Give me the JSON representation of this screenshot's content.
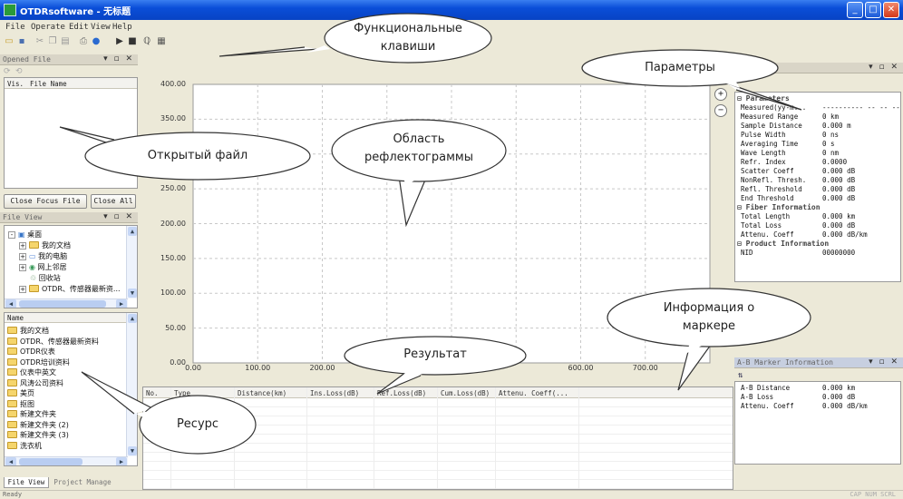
{
  "window": {
    "title": "OTDRsoftware - 无标题"
  },
  "menu": [
    "File",
    "Operate",
    "Edit",
    "View",
    "Help"
  ],
  "opened_file": {
    "title": "Opened File",
    "columns": [
      "Vis.",
      "File Name"
    ],
    "close_focus": "Close Focus File",
    "close_all": "Close All"
  },
  "file_view": {
    "title": "File View",
    "tree": [
      {
        "label": "桌面",
        "level": 0,
        "pm": "-"
      },
      {
        "label": "我的文档",
        "level": 1,
        "pm": "+"
      },
      {
        "label": "我的电脑",
        "level": 1,
        "pm": "+"
      },
      {
        "label": "网上邻居",
        "level": 1,
        "pm": "+"
      },
      {
        "label": "回收站",
        "level": 1,
        "pm": ""
      },
      {
        "label": "OTDR、传感器最新资...",
        "level": 1,
        "pm": "+"
      }
    ],
    "list_header": "Name",
    "list": [
      "我的文档",
      "OTDR、传感器最新资料",
      "OTDR仪表",
      "OTDR培训资料",
      "仪表中英文",
      "风涛公司资料",
      "美页",
      "抠图",
      "新建文件夹",
      "新建文件夹 (2)",
      "新建文件夹 (3)",
      "洗衣机"
    ],
    "tabs": [
      "File View",
      "Project Manage"
    ]
  },
  "chart_data": {
    "type": "line",
    "series": [],
    "x_ticks": [
      "0.00",
      "100.00",
      "200.00",
      "600.00",
      "700.00"
    ],
    "y_ticks": [
      "400.00",
      "350.00",
      "250.00",
      "200.00",
      "150.00",
      "100.00",
      "50.00",
      "0.00"
    ],
    "xlim": [
      0,
      800
    ],
    "ylim": [
      0,
      400
    ],
    "grid": true
  },
  "results": {
    "columns": [
      "No.",
      "Type",
      "Distance(km)",
      "Ins.Loss(dB)",
      "Ref.Loss(dB)",
      "Cum.Loss(dB)",
      "Attenu. Coeff(..."
    ]
  },
  "parameters": {
    "section1_title": "Parameters",
    "rows": [
      [
        "Measured(yy-m...",
        "---------- -- -- --"
      ],
      [
        "Measured Range",
        "0 km"
      ],
      [
        "Sample Distance",
        "0.000 m"
      ],
      [
        "Pulse Width",
        "0 ns"
      ],
      [
        "Averaging Time",
        "0 s"
      ],
      [
        "Wave Length",
        "0 nm"
      ],
      [
        "Refr. Index",
        "0.0000"
      ],
      [
        "Scatter Coeff",
        "0.000 dB"
      ],
      [
        "NonRefl. Thresh.",
        "0.000 dB"
      ],
      [
        "Refl. Threshold",
        "0.000 dB"
      ],
      [
        "End Threshold",
        "0.000 dB"
      ]
    ],
    "section2_title": "Fiber Information",
    "rows2": [
      [
        "Total Length",
        "0.000 km"
      ],
      [
        "Total Loss",
        "0.000 dB"
      ],
      [
        "Attenu. Coeff",
        "0.000 dB/km"
      ]
    ],
    "section3_title": "Product Information",
    "rows3": [
      [
        "NID",
        "00000000"
      ]
    ]
  },
  "marker": {
    "title": "A-B Marker Information",
    "rows": [
      [
        "A-B Distance",
        "0.000 km"
      ],
      [
        "A-B Loss",
        "0.000 dB"
      ],
      [
        "Attenu. Coeff",
        "0.000 dB/km"
      ]
    ]
  },
  "status": {
    "left": "Ready",
    "right": "CAP NUM SCRL"
  },
  "callouts": {
    "keys": "Функциональные\nклавиши",
    "params": "Параметры",
    "opened": "Открытый файл",
    "trace": "Область\nрефлектограммы",
    "marker": "Информация о\nмаркере",
    "result": "Результат",
    "resource": "Ресурс"
  },
  "colors": {
    "titlebar": "#0a4ed8",
    "chrome": "#ece9d8",
    "grid": "#c8c8c8"
  }
}
